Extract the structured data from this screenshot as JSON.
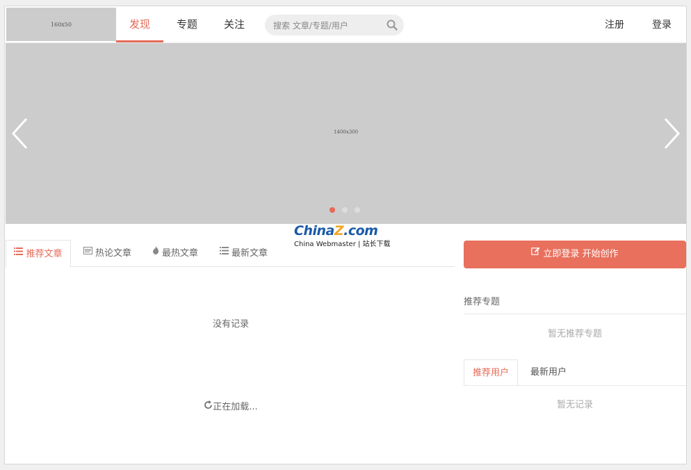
{
  "header": {
    "logo_placeholder": "160x50",
    "nav": [
      {
        "label": "发现",
        "active": true
      },
      {
        "label": "专题",
        "active": false
      },
      {
        "label": "关注",
        "active": false
      }
    ],
    "search": {
      "placeholder": "搜索 文章/专题/用户",
      "icon": "search-icon"
    },
    "register_label": "注册",
    "login_label": "登录"
  },
  "banner": {
    "placeholder": "1400x300",
    "prev_icon": "chevron-left-icon",
    "next_icon": "chevron-right-icon",
    "slides_count": 3,
    "active_slide": 1
  },
  "watermark": {
    "brand": "ChinaZ.com",
    "brand_main": "China",
    "brand_z": "Z",
    "brand_tail": ".com",
    "subtitle": "China Webmaster | 站长下载"
  },
  "article_tabs": [
    {
      "label": "推荐文章",
      "icon": "list-icon",
      "active": true
    },
    {
      "label": "热论文章",
      "icon": "comment-icon",
      "active": false
    },
    {
      "label": "最热文章",
      "icon": "fire-icon",
      "active": false
    },
    {
      "label": "最新文章",
      "icon": "list-icon",
      "active": false
    }
  ],
  "articles": {
    "empty_text": "没有记录",
    "loading_text": "正在加载..."
  },
  "sidebar": {
    "cta_label": "立即登录 开始创作",
    "cta_icon": "edit-icon",
    "topics_title": "推荐专题",
    "topics_empty": "暂无推荐专题",
    "user_tabs": [
      {
        "label": "推荐用户",
        "active": true
      },
      {
        "label": "最新用户",
        "active": false
      }
    ],
    "users_empty": "暂无记录"
  },
  "colors": {
    "accent": "#e66a57",
    "cta_bg": "#e8705d",
    "placeholder_bg": "#cccccc"
  }
}
